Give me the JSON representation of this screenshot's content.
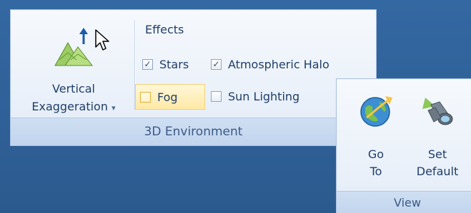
{
  "ribbon": {
    "environment_group": {
      "caption": "3D Environment",
      "vertical_exaggeration": {
        "line1": "Vertical",
        "line2": "Exaggeration",
        "dropdown_glyph": "▾",
        "icon": "mountain-up-arrow-icon"
      },
      "effects": {
        "title": "Effects",
        "stars": {
          "label": "Stars",
          "checked": true
        },
        "atmospheric_halo": {
          "label": "Atmospheric Halo",
          "checked": true
        },
        "fog": {
          "label": "Fog",
          "checked": false,
          "hovered": true
        },
        "sun_lighting": {
          "label": "Sun Lighting",
          "checked": false
        }
      }
    },
    "view_group": {
      "caption": "View",
      "go_to": {
        "line1": "Go",
        "line2": "To",
        "icon": "globe-arrow-icon"
      },
      "set_default": {
        "line1": "Set",
        "line2": "Default",
        "icon": "binoculars-icon"
      }
    }
  },
  "colors": {
    "desktop_background": "#2f5f95",
    "ribbon_face": "#e9f0f9",
    "caption_bar": "#c7d9f0",
    "text": "#1f3e69",
    "hover_highlight": "#ffe9a6"
  }
}
